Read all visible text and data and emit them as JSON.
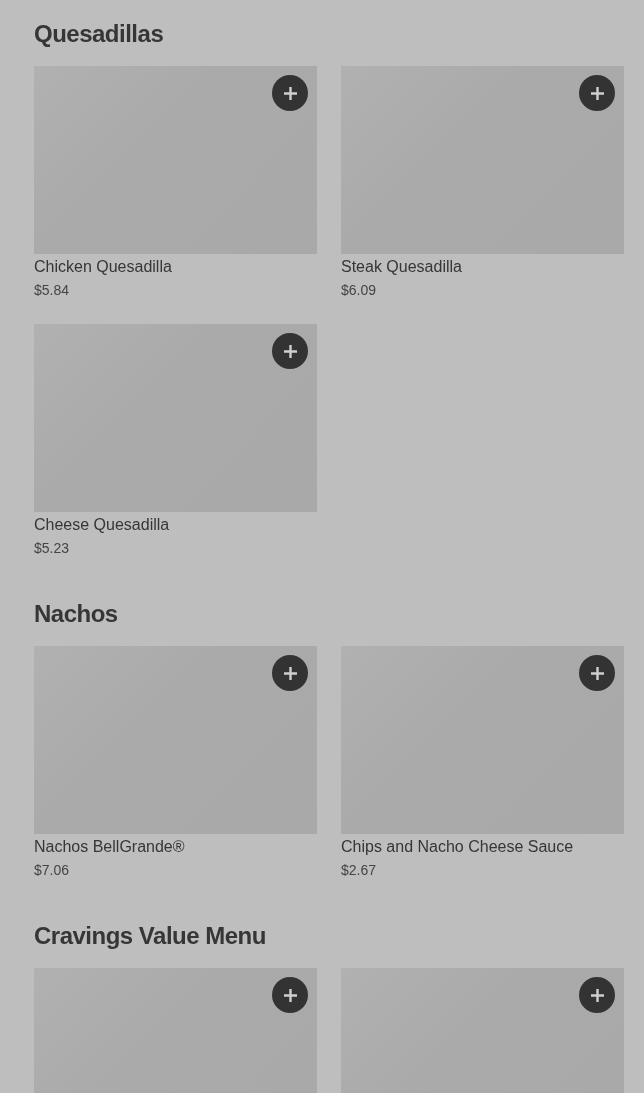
{
  "sections": [
    {
      "title": "Quesadillas",
      "items": [
        {
          "kind": "item",
          "name": "Chicken Quesadilla",
          "price": "$5.84"
        },
        {
          "kind": "item",
          "name": "Steak Quesadilla",
          "price": "$6.09"
        },
        {
          "kind": "item",
          "name": "Cheese Quesadilla",
          "price": "$5.23"
        }
      ]
    },
    {
      "title": "Nachos",
      "items": [
        {
          "kind": "item",
          "name": "Nachos BellGrande®",
          "price": "$7.06"
        },
        {
          "kind": "item",
          "name": "Chips and Nacho Cheese Sauce",
          "price": "$2.67"
        }
      ]
    },
    {
      "title": "Cravings Value Menu",
      "items": [
        {
          "kind": "image-only"
        },
        {
          "kind": "image-only"
        }
      ]
    }
  ]
}
